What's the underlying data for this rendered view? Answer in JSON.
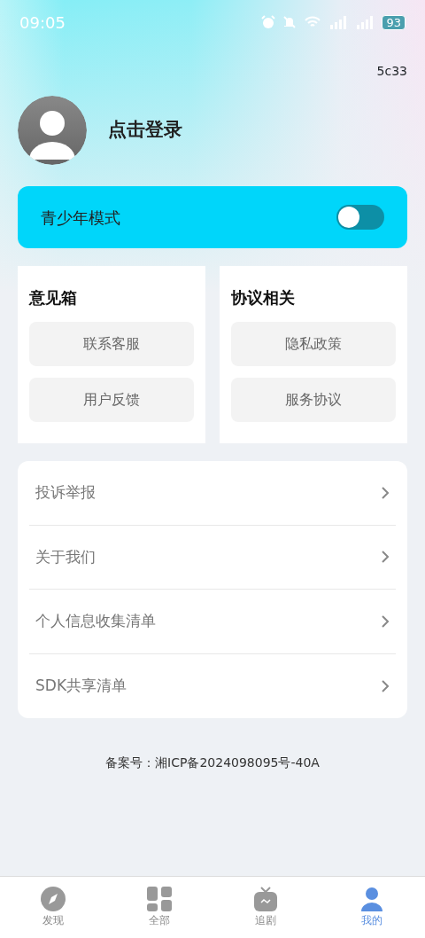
{
  "status_bar": {
    "time": "09:05",
    "battery": "93"
  },
  "version": "5c33",
  "profile": {
    "login_label": "点击登录"
  },
  "teen_mode": {
    "label": "青少年模式",
    "on": false
  },
  "sections": [
    {
      "title": "意见箱",
      "buttons": [
        "联系客服",
        "用户反馈"
      ]
    },
    {
      "title": "协议相关",
      "buttons": [
        "隐私政策",
        "服务协议"
      ]
    }
  ],
  "menu": [
    "投诉举报",
    "关于我们",
    "个人信息收集清单",
    "SDK共享清单"
  ],
  "icp": "备案号：湘ICP备2024098095号-40A",
  "tabs": [
    {
      "label": "发现",
      "kind": "compass",
      "selected": false
    },
    {
      "label": "全部",
      "kind": "grid",
      "selected": false
    },
    {
      "label": "追剧",
      "kind": "tv",
      "selected": false
    },
    {
      "label": "我的",
      "kind": "user",
      "selected": true
    }
  ]
}
